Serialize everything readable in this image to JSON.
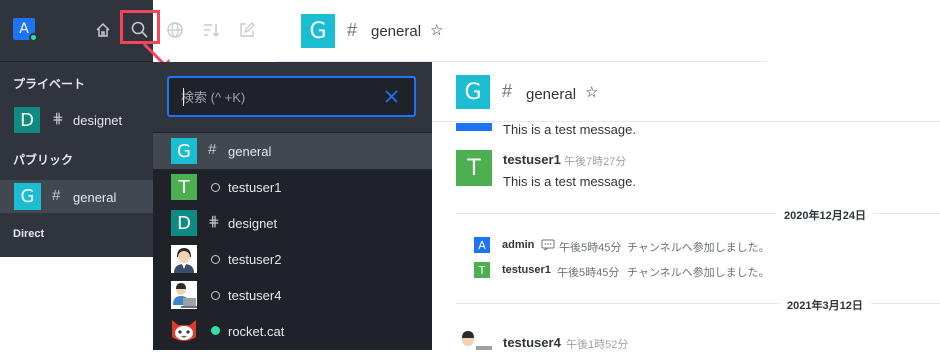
{
  "sidebar": {
    "user_initial": "A",
    "sections": {
      "private": "プライベート",
      "public": "パブリック",
      "direct": "Direct"
    },
    "items": [
      {
        "initial": "D",
        "label": "designet",
        "color": "#0e8c83"
      },
      {
        "initial": "G",
        "label": "general",
        "color": "#1cbcd2"
      }
    ]
  },
  "top_header": {
    "initial": "G",
    "title": "general"
  },
  "search": {
    "placeholder": "検索 (^ +K)",
    "results": [
      {
        "initial": "G",
        "label": "general",
        "color": "#1cbcd2",
        "kind": "channel"
      },
      {
        "initial": "T",
        "label": "testuser1",
        "color": "#4caf50",
        "kind": "user-offline"
      },
      {
        "initial": "D",
        "label": "designet",
        "color": "#0e8c83",
        "kind": "private"
      },
      {
        "initial": "",
        "label": "testuser2",
        "color": "",
        "kind": "user-offline"
      },
      {
        "initial": "",
        "label": "testuser4",
        "color": "",
        "kind": "user-offline"
      },
      {
        "initial": "",
        "label": "rocket.cat",
        "color": "",
        "kind": "user-online"
      }
    ]
  },
  "room": {
    "initial": "G",
    "title": "general",
    "messages": [
      {
        "body": "This is a test message."
      },
      {
        "initial": "T",
        "user": "testuser1",
        "time": "午後7時27分",
        "body": "This is a test message."
      }
    ],
    "dates": [
      "2020年12月24日",
      "2021年3月12日"
    ],
    "system": [
      {
        "initial": "A",
        "user": "admin",
        "time": "午後5時45分",
        "text": "チャンネルへ参加しました。"
      },
      {
        "initial": "T",
        "user": "testuser1",
        "time": "午後5時45分",
        "text": "チャンネルへ参加しました。"
      }
    ],
    "last": {
      "user": "testuser4",
      "time": "午後1時52分"
    }
  },
  "colors": {
    "accent": "#1d74f5",
    "highlight": "#f5455c",
    "online": "#2de0a5"
  }
}
